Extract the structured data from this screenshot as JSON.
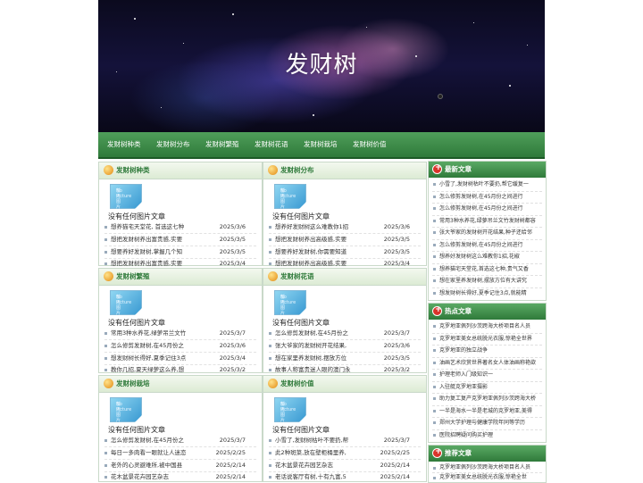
{
  "site_title": "发财树",
  "nav": [
    "发财树种类",
    "发财树分布",
    "发财树繁殖",
    "发财树花语",
    "发财树栽培",
    "发财树价值"
  ],
  "no_picture": {
    "line1": "No Picture",
    "line2": "暂无图片"
  },
  "panels": [
    {
      "title": "发财树种类",
      "notext": "没有任何图片文章",
      "items": [
        {
          "t": "想养猫宅天堂花, 首选这七种",
          "d": "2025/3/6"
        },
        {
          "t": "想把发财树养出富贵感,实要",
          "d": "2025/3/5"
        },
        {
          "t": "想要养好发财树,掌握几个知",
          "d": "2025/3/5"
        },
        {
          "t": "想把发财树养出富贵感,实要",
          "d": "2025/3/4"
        }
      ]
    },
    {
      "title": "发财树分布",
      "notext": "没有任何图片文章",
      "items": [
        {
          "t": "想养好发财树这么难教你1招",
          "d": "2025/3/6"
        },
        {
          "t": "想把发财树养出高级感,实要",
          "d": "2025/3/5"
        },
        {
          "t": "想要养好发财树,你需要知道",
          "d": "2025/3/5"
        },
        {
          "t": "想把发财树养出高级感,实要",
          "d": "2025/3/4"
        }
      ]
    },
    {
      "title": "发财树繁殖",
      "notext": "没有任何图片文章",
      "items": [
        {
          "t": "常用3种水养花,绿萝吊兰文竹",
          "d": "2025/3/7"
        },
        {
          "t": "怎么修剪发财树,在45月份之",
          "d": "2025/3/6"
        },
        {
          "t": "想发财树长得好,夏季记住3点",
          "d": "2025/3/4"
        },
        {
          "t": "教你几招,夏天绿萝这么养,想",
          "d": "2025/3/2"
        }
      ]
    },
    {
      "title": "发财树花语",
      "notext": "没有任何图片文章",
      "items": [
        {
          "t": "怎么修剪发财树,在45月份之",
          "d": "2025/3/7"
        },
        {
          "t": "张大爷家的发财树开花结果,",
          "d": "2025/3/6"
        },
        {
          "t": "想在家里养发财树,摆放方位",
          "d": "2025/3/5"
        },
        {
          "t": "故事人称富贵迷人眼的澳门永",
          "d": "2025/3/2"
        }
      ]
    },
    {
      "title": "发财树栽培",
      "notext": "没有任何图片文章",
      "items": [
        {
          "t": "怎么修剪发财树,在45月份之",
          "d": "2025/3/7"
        },
        {
          "t": "每日一多肉看一眼就让人迷恋",
          "d": "2025/2/25"
        },
        {
          "t": "老外的心灵避难所,被中国县",
          "d": "2025/2/14"
        },
        {
          "t": "花木盆景花卉园艺杂志",
          "d": "2025/2/14"
        }
      ]
    },
    {
      "title": "发财树价值",
      "notext": "没有任何图片文章",
      "items": [
        {
          "t": "小雪了,发财树枯叶不要扔,帮",
          "d": "2025/3/7"
        },
        {
          "t": "此2种斑菜,放在壁柜桶里养,",
          "d": "2025/2/25"
        },
        {
          "t": "花木盆景花卉园艺杂志",
          "d": "2025/2/14"
        },
        {
          "t": "老话说客厅有树,十有九富,5",
          "d": "2025/2/14"
        }
      ]
    }
  ],
  "sidebar": [
    {
      "title": "最新文章",
      "items": [
        "小雪了,发财树枯叶不要扔,帮它缓复一",
        "怎么修剪发财树,在45月份之间进行",
        "怎么修剪发财树,在45月份之间进行",
        "常用3种水养花,绿萝吊兰文竹发财树都容",
        "张大爷家的发财树开花结果,种子还给邻",
        "怎么修剪发财树,在45月份之间进行",
        "想养好发财树这么难教你1招,花椒",
        "想养猫宅天堂花,首选这七种,贵气又香",
        "想在家里养发财树,摆放方位有大讲究",
        "想发财树长得好,夏季记住3点,就能精"
      ]
    },
    {
      "title": "热点文章",
      "items": [
        "克罗地亚佩列沙茨跨海大桥项目名人员",
        "克罗地亚美女总统脱光衣服,惊艳全世界",
        "克罗地亚的独立战争",
        "油画艺术欣赏世界著名女人体油画称艳欲",
        "护理老师入门级知识一",
        "入驻艇克罗地亚摄影",
        "助力复工复产克罗地亚佩列沙茨跨海大桥",
        "一半是海水一半是老城的克罗地亚,美得",
        "郑州大学护理与健康学院年同等学历",
        "医院招聘疑问购买护理"
      ]
    },
    {
      "title": "推荐文章",
      "items": [
        "克罗地亚佩列沙茨跨海大桥项目名人员",
        "克罗地亚美女总统脱光衣服,惊艳全世"
      ]
    }
  ]
}
